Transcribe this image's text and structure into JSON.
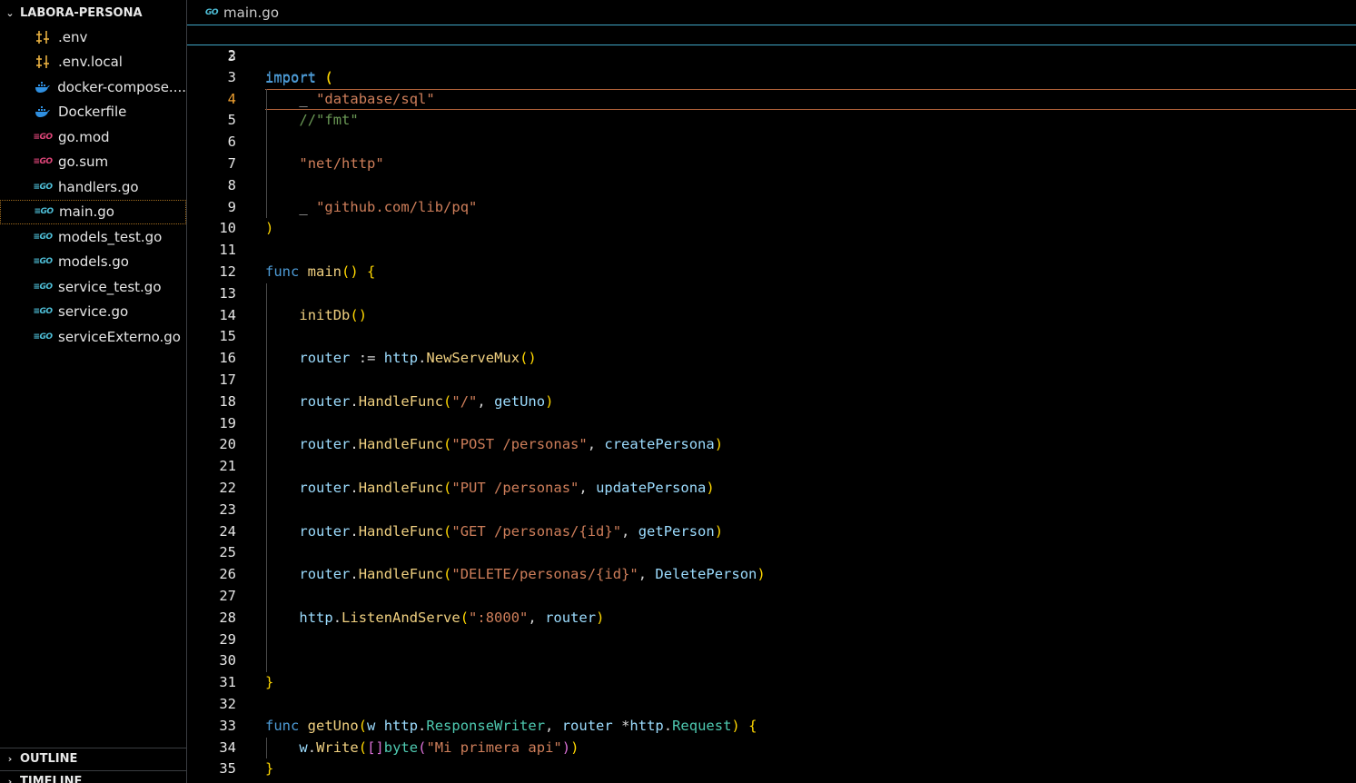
{
  "explorer": {
    "folder_name": "LABORA-PERSONA",
    "files": [
      {
        "name": ".env",
        "icon": "settings-sliders-icon"
      },
      {
        "name": ".env.local",
        "icon": "settings-sliders-icon"
      },
      {
        "name": "docker-compose....",
        "icon": "docker-whale-icon"
      },
      {
        "name": "Dockerfile",
        "icon": "docker-whale-icon"
      },
      {
        "name": "go.mod",
        "icon": "go-mod-icon"
      },
      {
        "name": "go.sum",
        "icon": "go-mod-icon"
      },
      {
        "name": "handlers.go",
        "icon": "go-file-icon"
      },
      {
        "name": "main.go",
        "icon": "go-file-icon",
        "active": true
      },
      {
        "name": "models_test.go",
        "icon": "go-file-icon"
      },
      {
        "name": "models.go",
        "icon": "go-file-icon"
      },
      {
        "name": "service_test.go",
        "icon": "go-file-icon"
      },
      {
        "name": "service.go",
        "icon": "go-file-icon"
      },
      {
        "name": "serviceExterno.go",
        "icon": "go-file-icon"
      }
    ],
    "outline_label": "OUTLINE",
    "timeline_label": "TIMELINE"
  },
  "editor": {
    "file_name": "main.go",
    "go_icon_text": "GO",
    "sticky": {
      "line": "3",
      "text": "import ("
    },
    "current_line": "4",
    "lines": [
      {
        "n": "2",
        "text": ""
      },
      {
        "n": "3",
        "text": "import ("
      },
      {
        "n": "4",
        "text": "    _ \"database/sql\""
      },
      {
        "n": "5",
        "text": "    //\"fmt\""
      },
      {
        "n": "6",
        "text": ""
      },
      {
        "n": "7",
        "text": "    \"net/http\""
      },
      {
        "n": "8",
        "text": ""
      },
      {
        "n": "9",
        "text": "    _ \"github.com/lib/pq\""
      },
      {
        "n": "10",
        "text": ")"
      },
      {
        "n": "11",
        "text": ""
      },
      {
        "n": "12",
        "text": "func main() {"
      },
      {
        "n": "13",
        "text": ""
      },
      {
        "n": "14",
        "text": "    initDb()"
      },
      {
        "n": "15",
        "text": ""
      },
      {
        "n": "16",
        "text": "    router := http.NewServeMux()"
      },
      {
        "n": "17",
        "text": ""
      },
      {
        "n": "18",
        "text": "    router.HandleFunc(\"/\", getUno)"
      },
      {
        "n": "19",
        "text": ""
      },
      {
        "n": "20",
        "text": "    router.HandleFunc(\"POST /personas\", createPersona)"
      },
      {
        "n": "21",
        "text": ""
      },
      {
        "n": "22",
        "text": "    router.HandleFunc(\"PUT /personas\", updatePersona)"
      },
      {
        "n": "23",
        "text": ""
      },
      {
        "n": "24",
        "text": "    router.HandleFunc(\"GET /personas/{id}\", getPerson)"
      },
      {
        "n": "25",
        "text": ""
      },
      {
        "n": "26",
        "text": "    router.HandleFunc(\"DELETE/personas/{id}\", DeletePerson)"
      },
      {
        "n": "27",
        "text": ""
      },
      {
        "n": "28",
        "text": "    http.ListenAndServe(\":8000\", router)"
      },
      {
        "n": "29",
        "text": ""
      },
      {
        "n": "30",
        "text": ""
      },
      {
        "n": "31",
        "text": "}"
      },
      {
        "n": "32",
        "text": ""
      },
      {
        "n": "33",
        "text": "func getUno(w http.ResponseWriter, router *http.Request) {"
      },
      {
        "n": "34",
        "text": "    w.Write([]byte(\"Mi primera api\"))"
      },
      {
        "n": "35",
        "text": "}"
      }
    ]
  },
  "colors": {
    "keyword": "#4d9bd6",
    "string": "#ce7e5a",
    "function": "#f0d080",
    "variable": "#9cdcfe",
    "type": "#4ec9b0",
    "comment": "#6a9955",
    "go_blue": "#4fc0d9",
    "go_pink": "#e0467a"
  }
}
